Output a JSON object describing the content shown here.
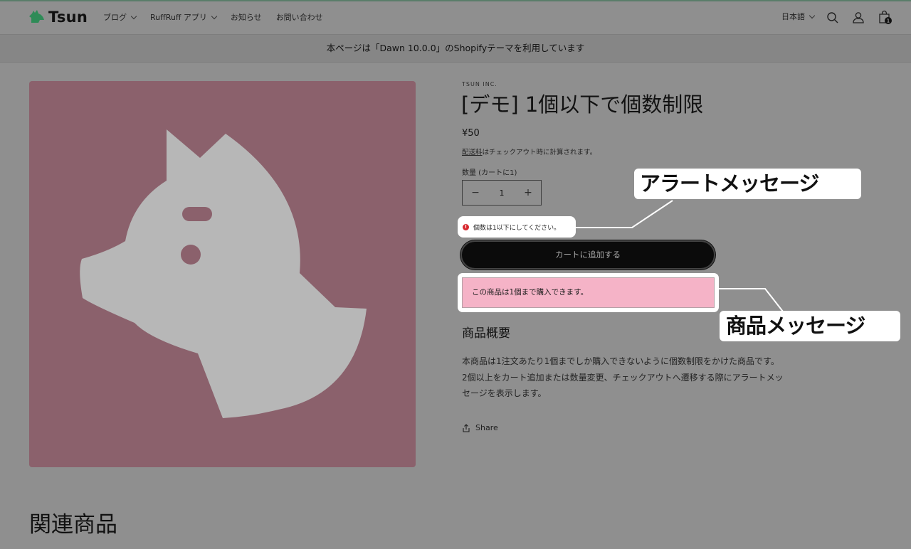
{
  "header": {
    "logo_text": "Tsun",
    "nav": [
      {
        "label": "ブログ",
        "has_dropdown": true
      },
      {
        "label": "RuffRuff アプリ",
        "has_dropdown": true
      },
      {
        "label": "お知らせ",
        "has_dropdown": false
      },
      {
        "label": "お問い合わせ",
        "has_dropdown": false
      }
    ],
    "language": "日本語",
    "cart_count": "1",
    "icons": [
      "search-icon",
      "account-icon",
      "cart-icon"
    ]
  },
  "banner": {
    "text": "本ページは「Dawn 10.0.0」のShopifyテーマを利用しています"
  },
  "product": {
    "vendor": "TSUN INC.",
    "title": "[デモ] 1個以下で個数制限",
    "price": "¥50",
    "shipping_link": "配送料",
    "tax_note": "はチェックアウト時に計算されます。",
    "quantity_label": "数量 (カートに1)",
    "quantity_value": "1",
    "minus": "−",
    "plus": "+",
    "alert_message": "個数は1以下にしてください。",
    "add_to_cart": "カートに追加する",
    "product_message": "この商品は1個まで購入できます。",
    "description_title": "商品概要",
    "description_lines": [
      "本商品は1注文あたり1個までしか購入できないように個数制限をかけた商品です。",
      "2個以上をカート追加または数量変更、チェックアウトへ遷移する際にアラートメッ",
      "セージを表示します。"
    ],
    "share": "Share"
  },
  "related_title": "関連商品",
  "annotations": {
    "alert_callout": "アラートメッセージ",
    "product_callout": "商品メッセージ"
  },
  "colors": {
    "overlay_gray": "#8f8f8f",
    "media_bg": "#8b616c",
    "product_message_bg": "#f5b3c7",
    "alert_red": "#d7282f",
    "button_black": "#0b0b0b",
    "logo_green": "#2e8b57"
  }
}
